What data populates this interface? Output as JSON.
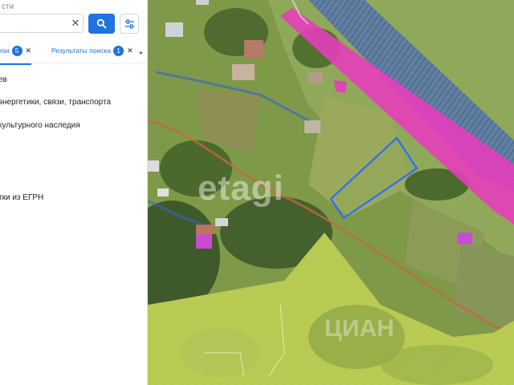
{
  "panel": {
    "search": {
      "placeholder": "сти",
      "value": ""
    },
    "tabs": [
      {
        "label": "лои",
        "count": "5"
      },
      {
        "label": "Результаты поиска",
        "count": "1"
      }
    ],
    "layers": [
      {
        "label": "ев"
      },
      {
        "label": "энергетики, связи, транспорта"
      },
      {
        "label": "культурного наследия"
      },
      {
        "label": "тки из ЕГРН"
      }
    ]
  },
  "map": {
    "watermark": "etagi",
    "watermark_secondary": "ЦИАН"
  },
  "colors": {
    "accent": "#1f73e0",
    "highlight_zone": "#e83bbd",
    "hatched_zone": "#3b5fd1",
    "parcel_outline": "#2e6bff",
    "forest_zone": "#d9e85a"
  },
  "icons": {
    "search": "search-icon",
    "filter": "filter-sliders-icon",
    "clear": "close-icon",
    "tab_close": "close-icon",
    "scroll_tabs": "chevron-right-icon"
  }
}
